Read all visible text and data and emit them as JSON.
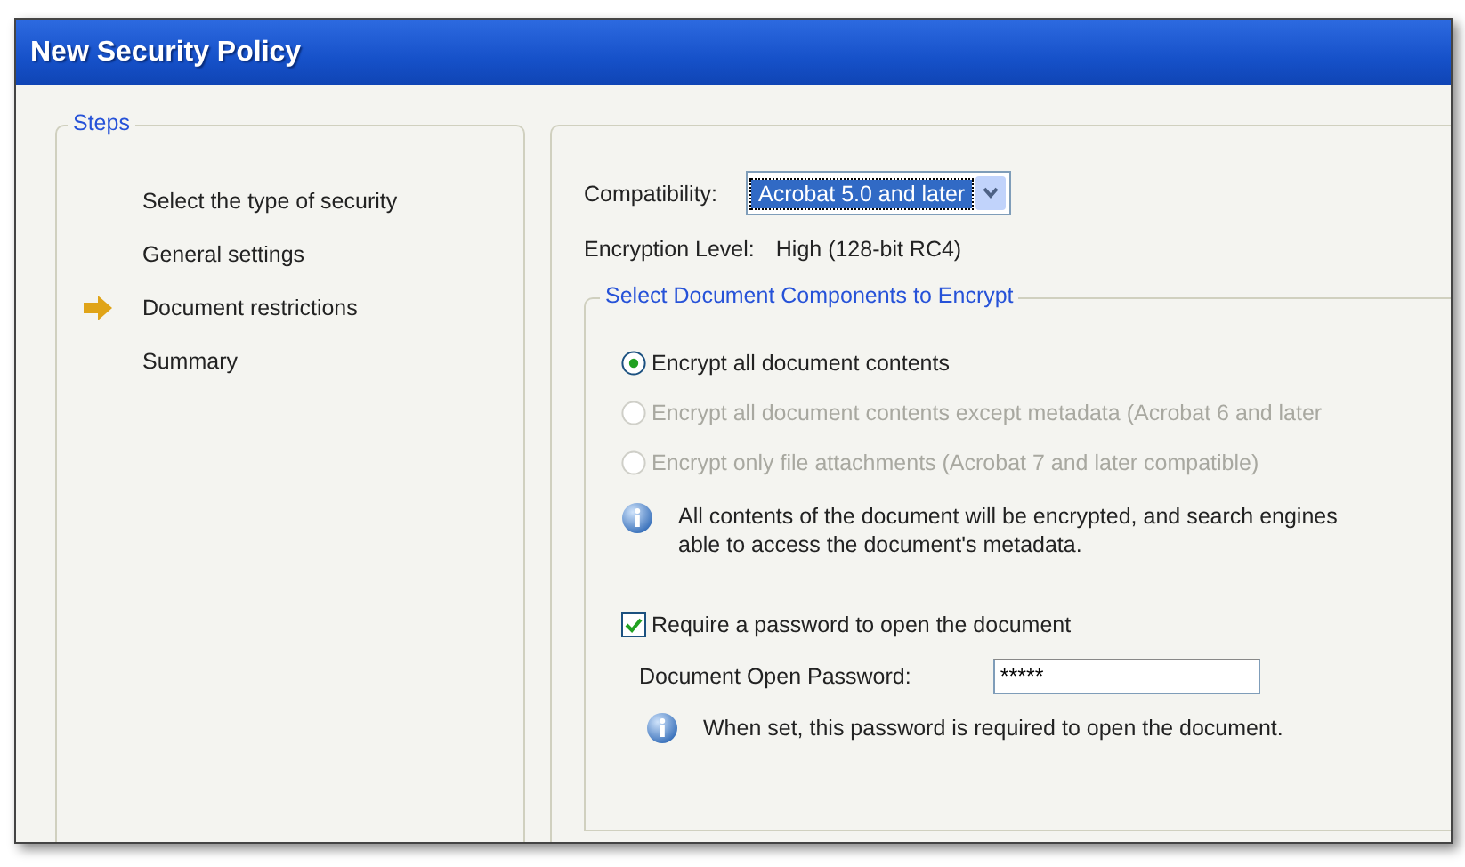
{
  "window": {
    "title": "New Security Policy"
  },
  "steps": {
    "title": "Steps",
    "items": [
      {
        "label": "Select the type of security",
        "selected": false
      },
      {
        "label": "General settings",
        "selected": false
      },
      {
        "label": "Document restrictions",
        "selected": true
      },
      {
        "label": "Summary",
        "selected": false
      }
    ]
  },
  "compatibility": {
    "label": "Compatibility:",
    "value": "Acrobat 5.0 and later"
  },
  "encryption_level": {
    "label": "Encryption Level:",
    "value": "High (128-bit RC4)"
  },
  "components": {
    "title": "Select Document Components to Encrypt",
    "options": [
      {
        "label": "Encrypt all document contents",
        "selected": true,
        "disabled": false
      },
      {
        "label": "Encrypt all document contents except metadata (Acrobat 6 and later",
        "selected": false,
        "disabled": true
      },
      {
        "label": "Encrypt only file attachments (Acrobat 7 and later compatible)",
        "selected": false,
        "disabled": true
      }
    ],
    "info": [
      "All contents of the document will be encrypted, and search engines",
      "able to access the document's metadata."
    ]
  },
  "open_password": {
    "label": "Require a password to open the document",
    "checked": true,
    "field_label": "Document Open Password:",
    "value": "*****",
    "info": "When set, this password is required to open the document."
  }
}
